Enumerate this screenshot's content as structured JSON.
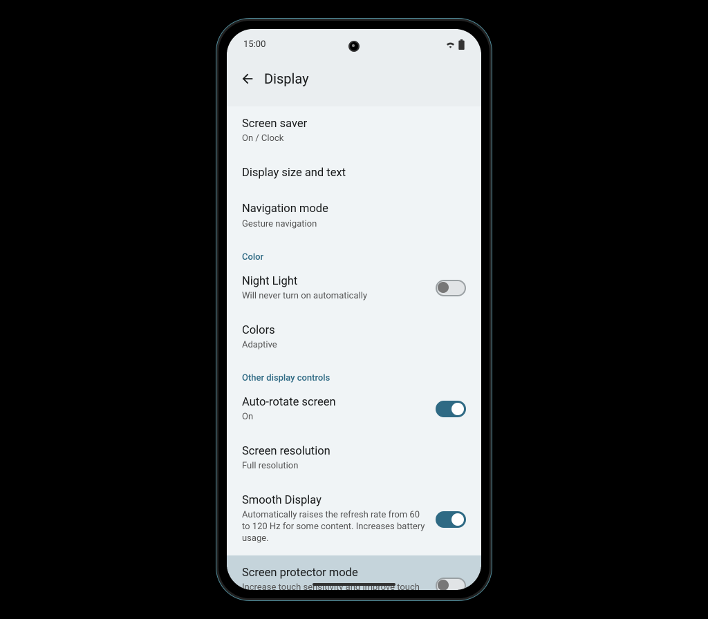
{
  "status": {
    "time": "15:00"
  },
  "header": {
    "title": "Display"
  },
  "items": {
    "screen_saver": {
      "title": "Screen saver",
      "sub": "On / Clock"
    },
    "display_size": {
      "title": "Display size and text"
    },
    "nav_mode": {
      "title": "Navigation mode",
      "sub": "Gesture navigation"
    },
    "night_light": {
      "title": "Night Light",
      "sub": "Will never turn on automatically"
    },
    "colors": {
      "title": "Colors",
      "sub": "Adaptive"
    },
    "auto_rotate": {
      "title": "Auto-rotate screen",
      "sub": "On"
    },
    "resolution": {
      "title": "Screen resolution",
      "sub": "Full resolution"
    },
    "smooth": {
      "title": "Smooth Display",
      "sub": "Automatically raises the refresh rate from 60 to 120 Hz for some content. Increases battery usage."
    },
    "protector": {
      "title": "Screen protector mode",
      "sub": "Increase touch sensitivity and improve touch when using a screen protector"
    }
  },
  "sections": {
    "color": "Color",
    "other": "Other display controls"
  }
}
